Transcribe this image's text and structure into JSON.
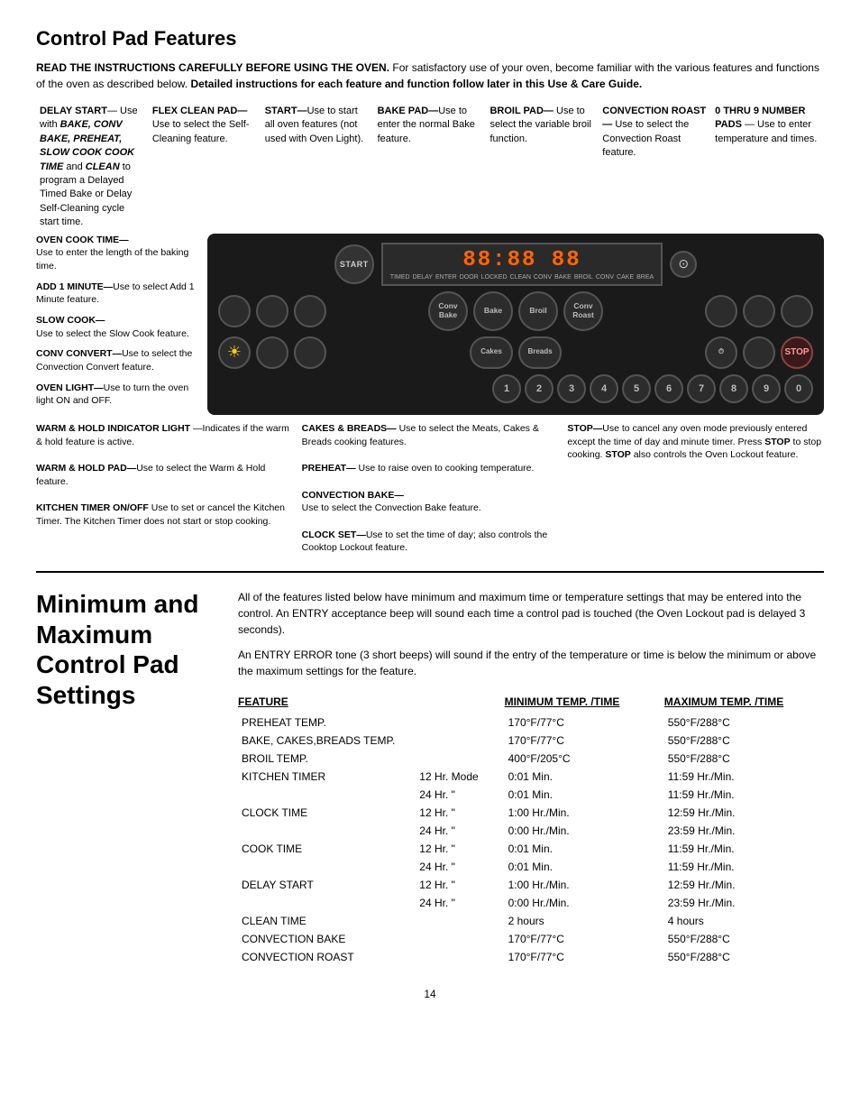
{
  "page": {
    "number": "14"
  },
  "section1": {
    "title": "Control Pad Features",
    "intro_bold": "READ THE INSTRUCTIONS CAREFULLY BEFORE USING THE OVEN.",
    "intro_normal": " For satisfactory use of your oven, become familiar with the various features and functions of the oven as described below. ",
    "intro_bold2": "Detailed instructions for each feature and function follow later in this Use & Care Guide.",
    "top_labels": [
      {
        "id": "delay-start",
        "head": "DELAY START",
        "rest": "— Use with BAKE, CONV BAKE, PREHEAT, SLOW COOK COOK TIME and CLEAN to program a Delayed Timed Bake or Delay Self-Cleaning cycle start time."
      },
      {
        "id": "flex-clean",
        "head": "FLEX CLEAN PAD—",
        "rest": " Use to select the Self-Cleaning feature."
      },
      {
        "id": "start-pad",
        "head": "START—",
        "rest": "Use to start all oven features (not used with Oven Light)."
      },
      {
        "id": "bake-pad",
        "head": "BAKE PAD—",
        "rest": "Use to enter the normal Bake feature."
      },
      {
        "id": "broil-pad",
        "head": "BROIL PAD—",
        "rest": " Use to select the variable broil function."
      },
      {
        "id": "conv-roast",
        "head": "CONVECTION ROAST—",
        "rest": " Use to select the Convection Roast feature."
      },
      {
        "id": "0-thru-9",
        "head": "0 THRU 9 NUMBER PADS",
        "rest": " — Use to enter temperature and times."
      }
    ],
    "left_labels": [
      {
        "id": "oven-cook-time",
        "head": "OVEN COOK TIME—",
        "rest": "Use to enter the length of the baking time."
      },
      {
        "id": "add-1-minute",
        "head": "ADD 1 MINUTE—",
        "rest": "Use to select Add 1 Minute feature."
      },
      {
        "id": "slow-cook",
        "head": "SLOW COOK—",
        "rest": "Use to select the Slow Cook feature."
      },
      {
        "id": "conv-convert",
        "head": "CONV CONVERT—",
        "rest": "Use to select the Convection Convert feature."
      },
      {
        "id": "oven-light",
        "head": "OVEN LIGHT—",
        "rest": "Use to turn the oven light ON and OFF."
      }
    ],
    "display_digits": "88:88 88",
    "display_sublabels": [
      "TIMED",
      "DELAY",
      "ENTER",
      "DOOR",
      "LOCKED",
      "CLEAN",
      "CONV",
      "BAKE",
      "BROIL",
      "CONV",
      "CAKE",
      "BREA"
    ],
    "buttons_row1": [
      "Conv\nBake",
      "Bake",
      "Broil",
      "Conv\nRoast"
    ],
    "buttons_row2_left": [
      "☀"
    ],
    "buttons_row2_mid": [
      "Cakes",
      "Breads"
    ],
    "buttons_row2_right": [
      "⏱",
      "STOP"
    ],
    "number_pads": [
      "0",
      "1",
      "2",
      "3",
      "4",
      "5",
      "6",
      "7",
      "8",
      "9"
    ],
    "below_labels": [
      {
        "id": "warm-hold-indicator",
        "head": "WARM & HOLD INDICATOR LIGHT",
        "rest": " —Indicates if the warm & hold feature is active."
      },
      {
        "id": "warm-hold-pad",
        "head": "WARM & HOLD PAD—",
        "rest": "Use to select the Warm & Hold feature."
      },
      {
        "id": "kitchen-timer",
        "head": "KITCHEN TIMER ON/OFF",
        "rest": " Use  to set or cancel the Kitchen Timer. The Kitchen Timer does not start or stop cooking."
      },
      {
        "id": "cakes-breads",
        "head": "CAKES & BREADS—",
        "rest": " Use to select the Meats, Cakes & Breads cooking features."
      },
      {
        "id": "preheat",
        "head": "PREHEAT—",
        "rest": " Use to raise oven to cooking temperature."
      },
      {
        "id": "convection-bake",
        "head": "CONVECTION BAKE—",
        "rest": "Use to select the Convection Bake feature."
      },
      {
        "id": "clock-set",
        "head": "CLOCK SET—",
        "rest": "Use to set the time of day; also controls the Cooktop Lockout feature."
      },
      {
        "id": "stop",
        "head": "STOP—",
        "rest": "Use to cancel any oven mode previously entered except the time of day and minute timer. Press STOP to stop cooking. STOP also controls the Oven Lockout feature."
      }
    ]
  },
  "section2": {
    "title": "Minimum and Maximum Control Pad Settings",
    "para1": "All of the features listed below have minimum and maximum time or temperature settings that may be entered into the control. An ENTRY acceptance beep will sound each time a control pad is touched (the Oven Lockout  pad is delayed 3 seconds).",
    "para2": "An ENTRY ERROR tone (3 short beeps) will sound if the entry of the temperature or time is below the minimum or above the maximum settings for the feature.",
    "table": {
      "headers": [
        "FEATURE",
        "",
        "MINIMUM TEMP. /TIME",
        "MAXIMUM TEMP. /TIME"
      ],
      "rows": [
        [
          "PREHEAT TEMP.",
          "",
          "170°F/77°C",
          "550°F/288°C"
        ],
        [
          "BAKE, CAKES,BREADS TEMP.",
          "",
          "170°F/77°C",
          "550°F/288°C"
        ],
        [
          "BROIL TEMP.",
          "",
          "400°F/205°C",
          "550°F/288°C"
        ],
        [
          "KITCHEN TIMER",
          "12 Hr. Mode",
          "0:01 Min.",
          "11:59 Hr./Min."
        ],
        [
          "",
          "24 Hr.  \"",
          "0:01 Min.",
          "11:59 Hr./Min."
        ],
        [
          "CLOCK TIME",
          "12 Hr.  \"",
          "1:00 Hr./Min.",
          "12:59 Hr./Min."
        ],
        [
          "",
          "24 Hr.  \"",
          "0:00 Hr./Min.",
          "23:59 Hr./Min."
        ],
        [
          "COOK TIME",
          "12 Hr.  \"",
          "0:01 Min.",
          "11:59 Hr./Min."
        ],
        [
          "",
          "24 Hr.  \"",
          "0:01 Min.",
          "11:59 Hr./Min."
        ],
        [
          "DELAY START",
          "12 Hr.  \"",
          "1:00 Hr./Min.",
          "12:59 Hr./Min."
        ],
        [
          "",
          "24 Hr.  \"",
          "0:00 Hr./Min.",
          "23:59 Hr./Min."
        ],
        [
          "CLEAN TIME",
          "",
          "2 hours",
          "4 hours"
        ],
        [
          "CONVECTION BAKE",
          "",
          "170°F/77°C",
          "550°F/288°C"
        ],
        [
          "CONVECTION ROAST",
          "",
          "170°F/77°C",
          "550°F/288°C"
        ]
      ]
    }
  }
}
